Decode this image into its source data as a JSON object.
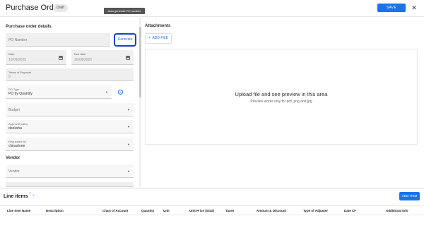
{
  "header": {
    "title": "Purchase Order",
    "badge": "Draft",
    "save_label": "SAVE",
    "close_glyph": "✕"
  },
  "details": {
    "section_title": "Purchase order details",
    "po_number": {
      "placeholder": "PO Number"
    },
    "generate_label": "Generate",
    "tooltip": "Auto generate PO number",
    "date": {
      "label": "Date",
      "value": "10/09/2025"
    },
    "due_date": {
      "label": "Due date",
      "value": "10/09/2025"
    },
    "terms": {
      "label": "Terms of Payment",
      "value": "0"
    },
    "po_type": {
      "label": "PO Type",
      "value": "PO by Quantity"
    },
    "budget": {
      "placeholder": "Budget"
    },
    "approval": {
      "label": "Approval policy",
      "value": "deeksha"
    },
    "requested_by": {
      "label": "Requested by",
      "value": "chirashree"
    },
    "vendor_title": "Vendor",
    "vendor": {
      "placeholder": "Vendor"
    },
    "info_glyph": "i",
    "caret_glyph": "▼"
  },
  "attachments": {
    "title": "Attachments",
    "add_file_label": "ADD FILE",
    "add_file_icon": "+",
    "drop_title": "Upload file and see preview in this area",
    "drop_subtitle": "Preview works only for pdf, png and jpg"
  },
  "line_items": {
    "title": "Line items",
    "sort_glyph": "⌃⌄",
    "add_item_label": "ADD ITEM",
    "columns": [
      "Line Item Name",
      "Description",
      "Chart of Account",
      "Quantity",
      "Unit",
      "Unit Price (SGD)",
      "Taxes",
      "Amount & Discount",
      "Type of Adjuster",
      "Date CF",
      "Additional Info"
    ]
  },
  "colors": {
    "accent": "#1a73e8",
    "focus_border": "#1a3fcc"
  }
}
